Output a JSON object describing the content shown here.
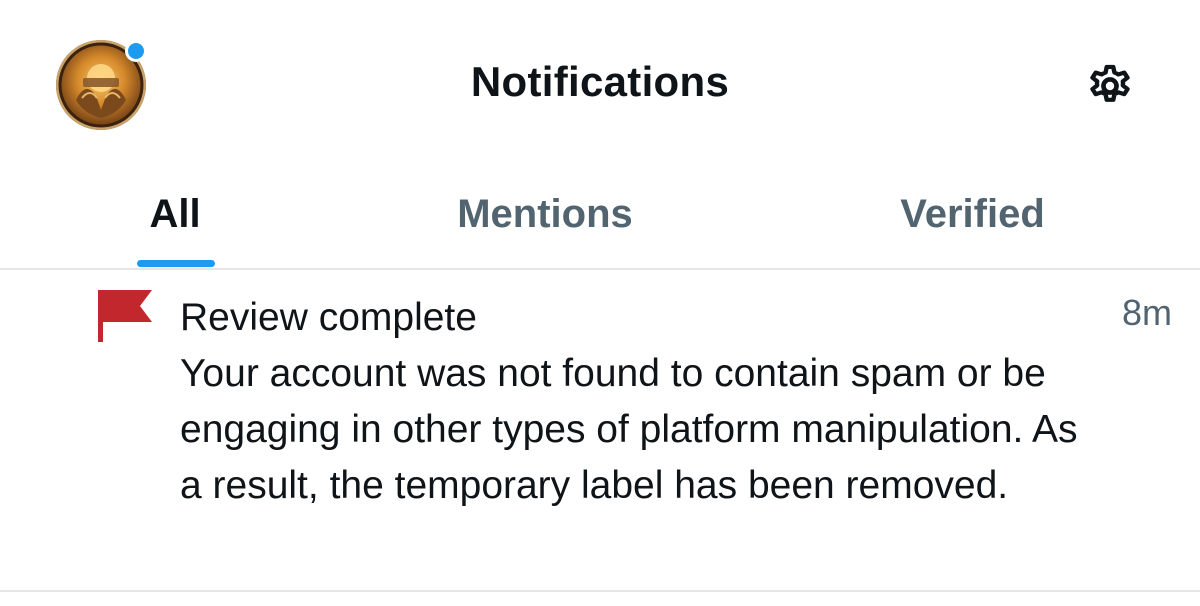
{
  "header": {
    "title": "Notifications",
    "avatar_icon": "profile-avatar",
    "settings_icon": "gear-icon",
    "unread_dot_color": "#1d9bf0"
  },
  "tabs": [
    {
      "label": "All",
      "active": true
    },
    {
      "label": "Mentions",
      "active": false
    },
    {
      "label": "Verified",
      "active": false
    }
  ],
  "accent_color": "#1d9bf0",
  "notifications": [
    {
      "icon": "flag-icon",
      "icon_color": "#c1272d",
      "title": "Review complete",
      "text": "Your account was not found to contain spam or be engaging in other types of platform manipulation. As a result, the temporary label has been removed.",
      "time": "8m"
    }
  ]
}
